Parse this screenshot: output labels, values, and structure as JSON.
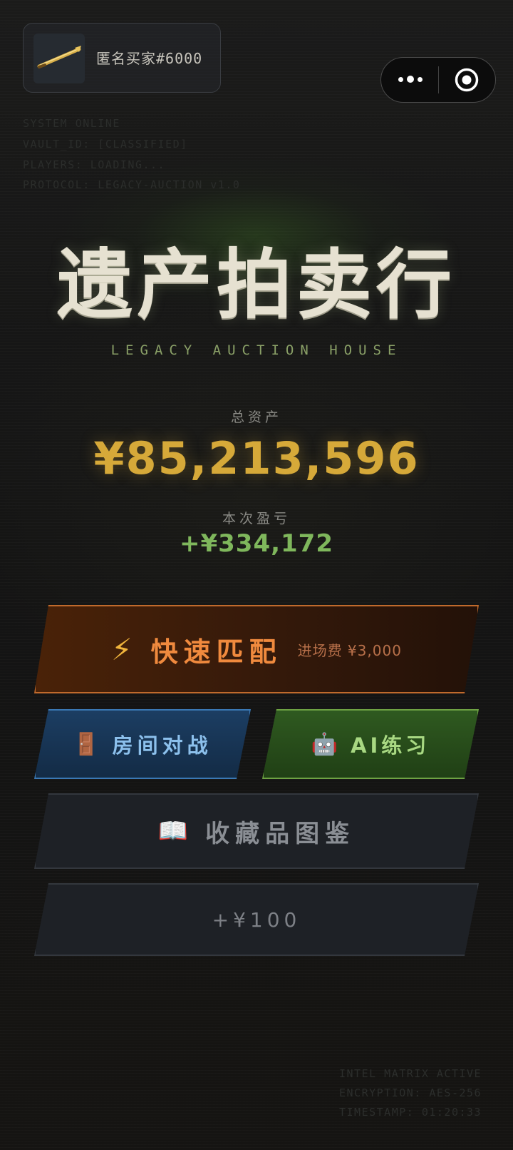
{
  "user": {
    "avatar_icon": "golden-pen-icon",
    "name": "匿名买家#6000"
  },
  "capsule": {
    "more_icon": "more-dots-icon",
    "close_icon": "target-close-icon"
  },
  "system_lines": [
    "SYSTEM ONLINE",
    "VAULT_ID: [CLASSIFIED]",
    "PLAYERS: LOADING...",
    "PROTOCOL: LEGACY-AUCTION v1.0"
  ],
  "header": {
    "title": "遗产拍卖行",
    "subtitle": "LEGACY AUCTION HOUSE"
  },
  "stats": {
    "total_label": "总资产",
    "total_value": "¥85,213,596",
    "pnl_label": "本次盈亏",
    "pnl_value": "+¥334,172"
  },
  "actions": {
    "quick_match": {
      "icon": "⚡",
      "label": "快速匹配",
      "fee": "进场费 ¥3,000"
    },
    "room_battle": {
      "icon": "🚪",
      "label": "房间对战"
    },
    "ai_practice": {
      "icon": "🤖",
      "label": "AI练习"
    },
    "collection": {
      "icon": "📖",
      "label": "收藏品图鉴"
    },
    "bonus": {
      "label": "+¥100"
    }
  },
  "footer_lines": [
    "INTEL MATRIX ACTIVE",
    "ENCRYPTION: AES-256",
    "TIMESTAMP: 01:20:33"
  ],
  "colors": {
    "gold": "#d6a939",
    "green": "#7fb75c",
    "orange": "#f08a3e",
    "blue": "#8cc0ec",
    "light_green": "#a8d882"
  }
}
